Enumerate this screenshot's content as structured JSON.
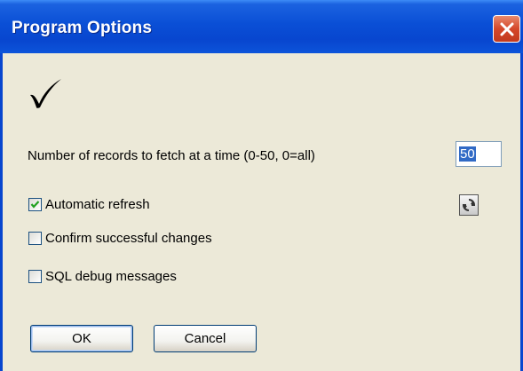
{
  "window": {
    "title": "Program Options"
  },
  "options": {
    "records_label": "Number of records to fetch at a time (0-50, 0=all)",
    "records_value": "50",
    "checkboxes": [
      {
        "label": "Automatic refresh",
        "checked": true
      },
      {
        "label": "Confirm successful changes",
        "checked": false
      },
      {
        "label": "SQL debug messages",
        "checked": false
      }
    ]
  },
  "buttons": {
    "ok": "OK",
    "cancel": "Cancel"
  },
  "icons": {
    "close": "close-icon",
    "checkmark": "checkmark-icon",
    "refresh": "refresh-icon"
  },
  "colors": {
    "titlebar": "#0846cf",
    "close_button": "#d5472a",
    "dialog_bg": "#ece9d8",
    "selection": "#316ac5"
  }
}
